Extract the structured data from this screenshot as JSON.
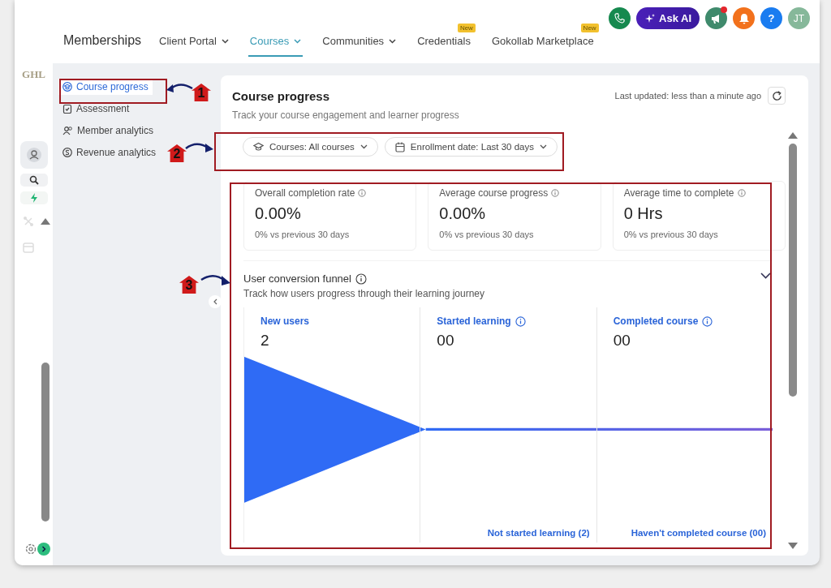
{
  "rail": {
    "logo": "GHL"
  },
  "header": {
    "title": "Memberships",
    "nav": [
      {
        "label": "Client Portal",
        "selected": false,
        "dropdown": true
      },
      {
        "label": "Courses",
        "selected": true,
        "dropdown": true
      },
      {
        "label": "Communities",
        "selected": false,
        "dropdown": true
      },
      {
        "label": "Credentials",
        "selected": false,
        "dropdown": false,
        "badge": "New"
      },
      {
        "label": "Gokollab Marketplace",
        "selected": false,
        "dropdown": false,
        "badge": "New"
      }
    ],
    "actions": [
      {
        "kind": "phone"
      },
      {
        "kind": "ai",
        "label": "Ask AI"
      },
      {
        "kind": "megaphone"
      },
      {
        "kind": "bell"
      },
      {
        "kind": "help",
        "label": "?"
      },
      {
        "kind": "avatar",
        "label": "JT"
      }
    ]
  },
  "sidebar": {
    "items": [
      {
        "kind": "cap",
        "label": "Course progress",
        "selected": true
      },
      {
        "kind": "clipboard",
        "label": "Assessment",
        "selected": false
      },
      {
        "kind": "users",
        "label": "Member analytics",
        "selected": false
      },
      {
        "kind": "dollar",
        "label": "Revenue analytics",
        "selected": false
      }
    ]
  },
  "panel": {
    "title": "Course progress",
    "subtitle": "Track your course engagement and learner progress",
    "last_updated": "Last updated: less than a minute ago",
    "filters": [
      {
        "kind": "cap",
        "label": "Courses: All courses"
      },
      {
        "kind": "calendar",
        "label": "Enrollment date: Last 30 days"
      }
    ],
    "metrics": [
      {
        "label": "Overall completion rate",
        "value": "0.00%",
        "change": "0% vs previous 30 days"
      },
      {
        "label": "Average course progress",
        "value": "0.00%",
        "change": "0% vs previous 30 days"
      },
      {
        "label": "Average time to complete",
        "value": "0 Hrs",
        "change": "0% vs previous 30 days"
      }
    ],
    "funnel": {
      "title": "User conversion funnel",
      "subtitle": "Track how users progress through their learning journey",
      "stages": [
        {
          "label": "New users",
          "value": "2",
          "info": false
        },
        {
          "label": "Started learning",
          "value": "00",
          "info": true,
          "dropoff": "Not started learning (2)"
        },
        {
          "label": "Completed course",
          "value": "00",
          "info": true,
          "dropoff": "Haven't completed course (00)"
        }
      ]
    }
  },
  "annotations": [
    {
      "number": "1"
    },
    {
      "number": "2"
    },
    {
      "number": "3"
    }
  ]
}
